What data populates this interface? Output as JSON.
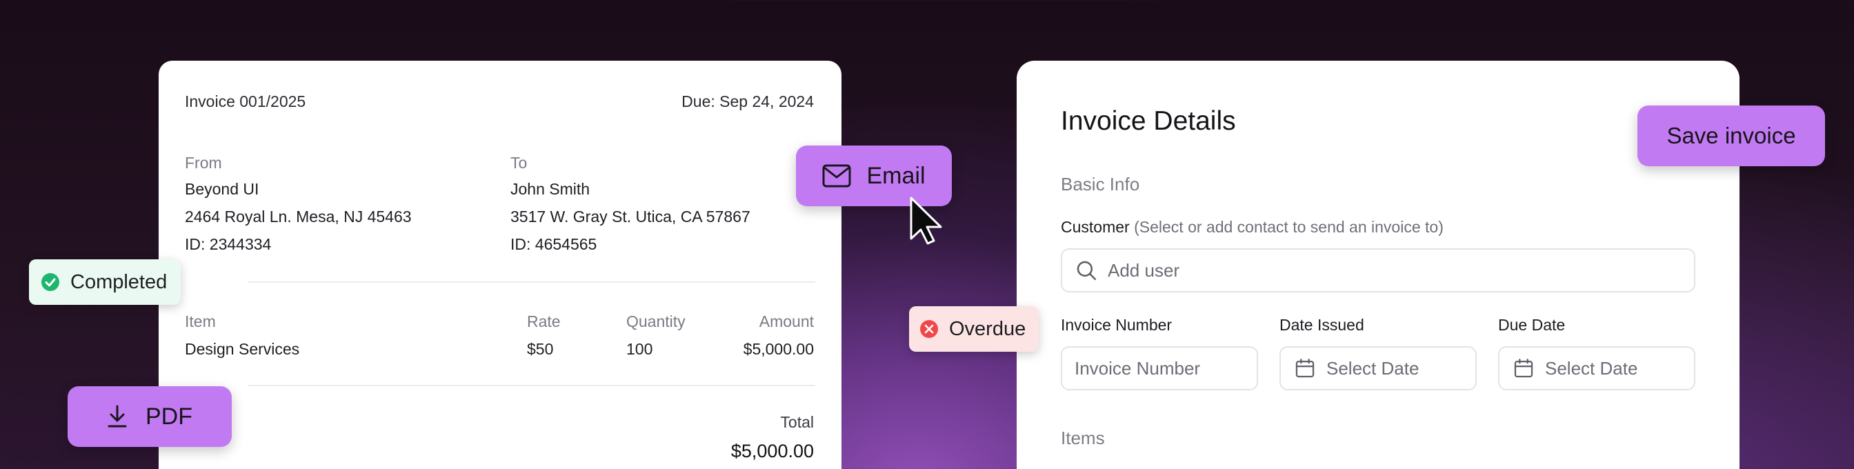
{
  "invoice_preview": {
    "number": "Invoice 001/2025",
    "due": "Due: Sep 24, 2024",
    "from": {
      "label": "From",
      "name": "Beyond UI",
      "address": "2464 Royal Ln. Mesa, NJ 45463",
      "id": "ID: 2344334"
    },
    "to": {
      "label": "To",
      "name": "John Smith",
      "address": "3517 W. Gray St. Utica, CA 57867",
      "id": "ID: 4654565"
    },
    "columns": [
      "Item",
      "Rate",
      "Quantity",
      "Amount"
    ],
    "rows": [
      [
        "Design Services",
        "$50",
        "100",
        "$5,000.00"
      ]
    ],
    "total_label": "Total",
    "total_value": "$5,000.00"
  },
  "details": {
    "title": "Invoice Details",
    "basic_info": "Basic Info",
    "customer_label": "Customer",
    "customer_hint": "(Select or add contact to send an invoice to)",
    "customer_placeholder": "Add user",
    "invoice_number_label": "Invoice Number",
    "invoice_number_placeholder": "Invoice Number",
    "date_issued_label": "Date Issued",
    "date_issued_placeholder": "Select Date",
    "due_date_label": "Due Date",
    "due_date_placeholder": "Select Date",
    "items_label": "Items"
  },
  "actions": {
    "email": "Email",
    "save": "Save invoice",
    "pdf": "PDF"
  },
  "badges": {
    "completed": "Completed",
    "overdue": "Overdue"
  },
  "colors": {
    "accent": "#c27af2",
    "success": "#1eb66e",
    "danger": "#f04848"
  },
  "icons": {
    "email": "mail-icon",
    "pdf": "download-icon",
    "search": "search-icon",
    "calendar": "calendar-icon",
    "completed": "check-circle-icon",
    "overdue": "x-circle-icon",
    "cursor": "pointer-cursor-icon"
  }
}
